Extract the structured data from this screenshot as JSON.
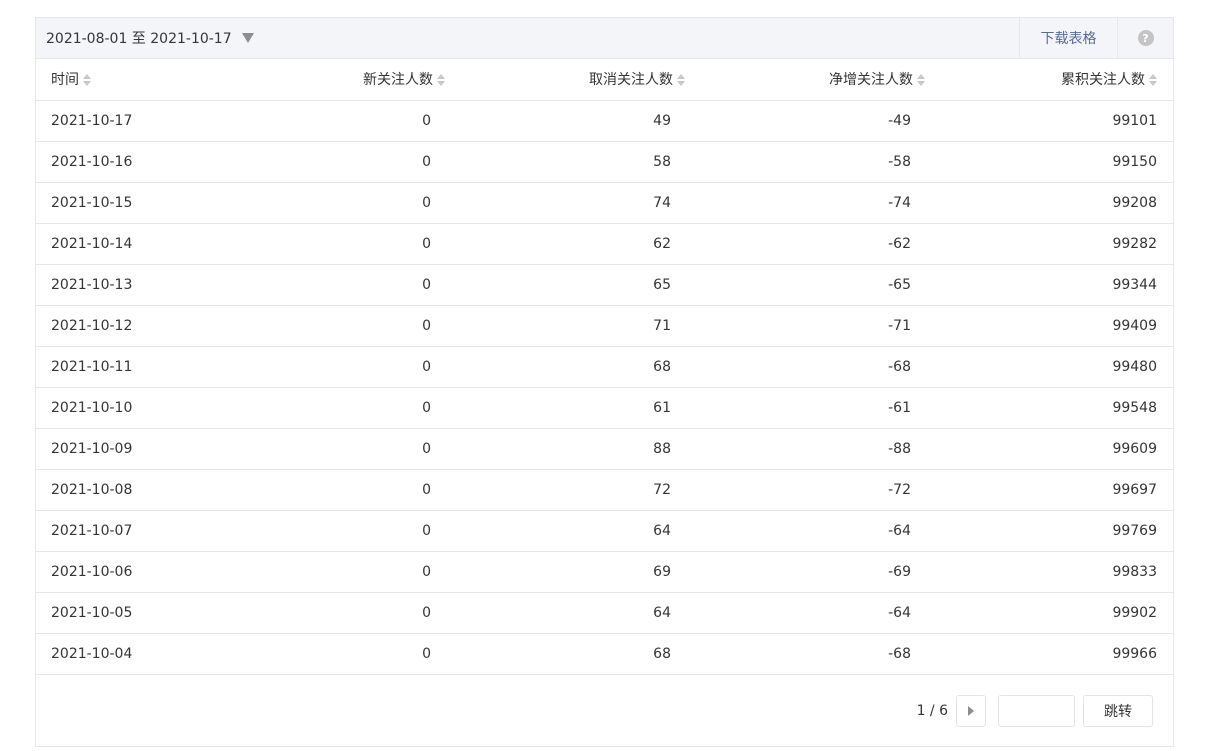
{
  "toolbar": {
    "date_range": "2021-08-01 至 2021-10-17",
    "download_label": "下载表格",
    "help_glyph": "?"
  },
  "table": {
    "columns": [
      "时间",
      "新关注人数",
      "取消关注人数",
      "净增关注人数",
      "累积关注人数"
    ],
    "rows": [
      [
        "2021-10-17",
        "0",
        "49",
        "-49",
        "99101"
      ],
      [
        "2021-10-16",
        "0",
        "58",
        "-58",
        "99150"
      ],
      [
        "2021-10-15",
        "0",
        "74",
        "-74",
        "99208"
      ],
      [
        "2021-10-14",
        "0",
        "62",
        "-62",
        "99282"
      ],
      [
        "2021-10-13",
        "0",
        "65",
        "-65",
        "99344"
      ],
      [
        "2021-10-12",
        "0",
        "71",
        "-71",
        "99409"
      ],
      [
        "2021-10-11",
        "0",
        "68",
        "-68",
        "99480"
      ],
      [
        "2021-10-10",
        "0",
        "61",
        "-61",
        "99548"
      ],
      [
        "2021-10-09",
        "0",
        "88",
        "-88",
        "99609"
      ],
      [
        "2021-10-08",
        "0",
        "72",
        "-72",
        "99697"
      ],
      [
        "2021-10-07",
        "0",
        "64",
        "-64",
        "99769"
      ],
      [
        "2021-10-06",
        "0",
        "69",
        "-69",
        "99833"
      ],
      [
        "2021-10-05",
        "0",
        "64",
        "-64",
        "99902"
      ],
      [
        "2021-10-04",
        "0",
        "68",
        "-68",
        "99966"
      ]
    ]
  },
  "pagination": {
    "page_info": "1 / 6",
    "page_input_value": "",
    "jump_label": "跳转"
  },
  "colors": {
    "link": "#576b95",
    "border": "#e7e7eb",
    "toolbar_bg": "#f4f5f9"
  }
}
